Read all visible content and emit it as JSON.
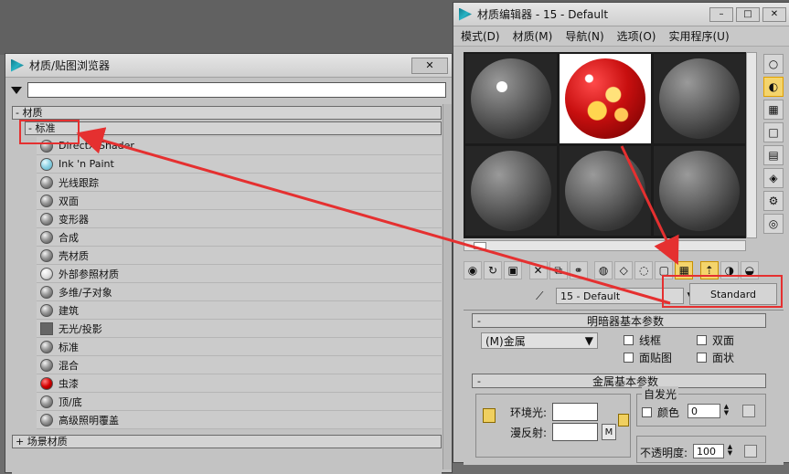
{
  "browser": {
    "title": "材质/贴图浏览器",
    "search_placeholder": "",
    "group_materials": "- 材质",
    "group_standard": "- 标准",
    "items": [
      {
        "label": "DirectX Shader",
        "icon": "gray"
      },
      {
        "label": "Ink 'n Paint",
        "icon": "cyan"
      },
      {
        "label": "光线跟踪",
        "icon": "gray"
      },
      {
        "label": "双面",
        "icon": "gray"
      },
      {
        "label": "变形器",
        "icon": "gray"
      },
      {
        "label": "合成",
        "icon": "gray"
      },
      {
        "label": "壳材质",
        "icon": "gray"
      },
      {
        "label": "外部参照材质",
        "icon": "white"
      },
      {
        "label": "多维/子对象",
        "icon": "gray"
      },
      {
        "label": "建筑",
        "icon": "gray"
      },
      {
        "label": "无光/投影",
        "icon": "flat"
      },
      {
        "label": "标准",
        "icon": "gray"
      },
      {
        "label": "混合",
        "icon": "gray"
      },
      {
        "label": "虫漆",
        "icon": "red"
      },
      {
        "label": "顶/底",
        "icon": "gray"
      },
      {
        "label": "高级照明覆盖",
        "icon": "gray"
      }
    ],
    "group_scene": "+ 场景材质"
  },
  "editor": {
    "title": "材质编辑器 - 15 - Default",
    "menus": [
      "模式(D)",
      "材质(M)",
      "导航(N)",
      "选项(O)",
      "实用程序(U)"
    ],
    "material_name": "15 - Default",
    "type_button": "Standard",
    "shader_rollout": "明暗器基本参数",
    "shader_type": "(M)金属",
    "cb_wire": "线框",
    "cb_2sided": "双面",
    "cb_facemap": "面贴图",
    "cb_faceted": "面状",
    "metal_rollout": "金属基本参数",
    "self_illum": "自发光",
    "ambient_label": "环境光:",
    "diffuse_label": "漫反射:",
    "color_label": "颜色",
    "color_value": "0",
    "opacity_label": "不透明度:",
    "opacity_value": "100",
    "m_label": "M"
  },
  "colors": {
    "annotation": "#e53030",
    "highlight": "#f4d46c"
  }
}
